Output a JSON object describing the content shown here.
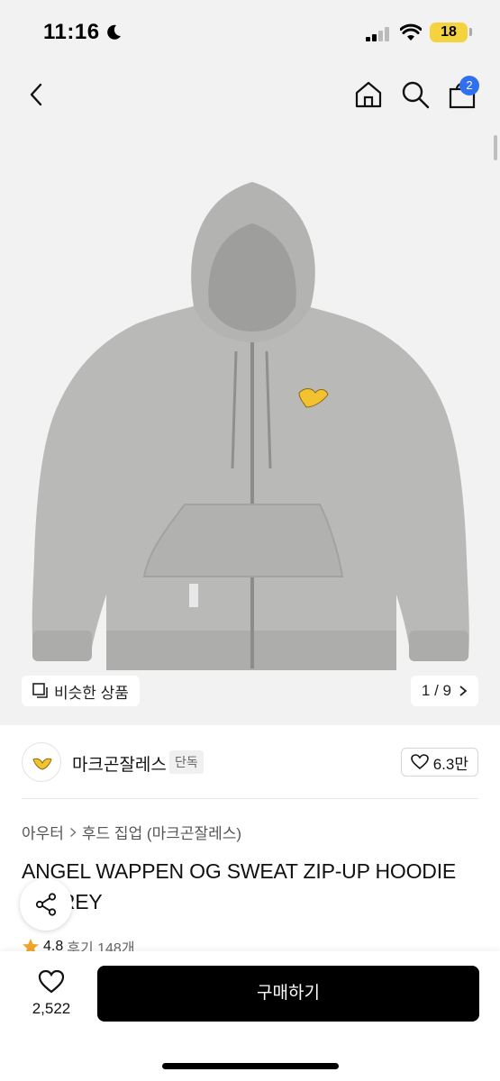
{
  "status_bar": {
    "time": "11:16",
    "battery": "18",
    "icons": [
      "moon-icon",
      "signal-icon",
      "wifi-icon",
      "battery-icon"
    ]
  },
  "nav": {
    "icons": [
      "back-icon",
      "home-icon",
      "search-icon",
      "shopping-bag-icon"
    ],
    "cart_count": "2"
  },
  "image": {
    "similar_label": "비슷한 상품",
    "page_indicator": "1 / 9",
    "colors": {
      "hoodie": "#b8b8b6",
      "emblem": "#f2c230",
      "background": "#f2f2f2"
    }
  },
  "brand": {
    "name": "마크곤잘레스",
    "tag": "단독",
    "likes": "6.3만",
    "logo_icon": "angel-logo-icon"
  },
  "product": {
    "breadcrumb": [
      "아우터",
      "후드 집업 (마크곤잘레스)"
    ],
    "title": "ANGEL WAPPEN OG SWEAT ZIP-UP HOODIE M/GREY",
    "rating": "4.8",
    "reviews": "후기 148개"
  },
  "bottom_bar": {
    "wish_count": "2,522",
    "buy_label": "구매하기"
  },
  "colors": {
    "buy_button": "#000000",
    "badge": "#2f6ff0",
    "star": "#f0a52a",
    "battery": "#f5d33f"
  }
}
